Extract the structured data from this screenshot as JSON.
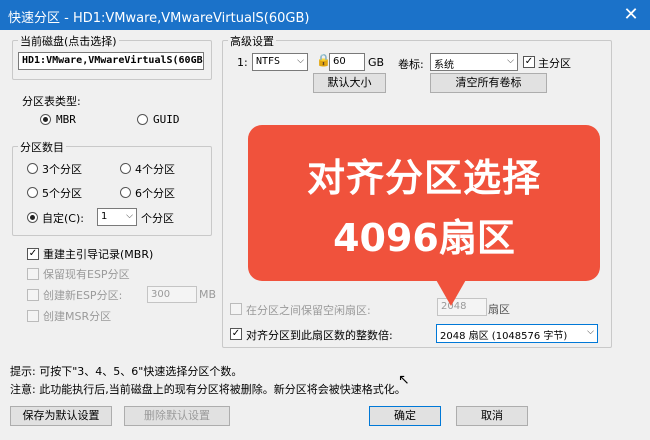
{
  "window": {
    "title": "快速分区 - HD1:VMware,VMwareVirtualS(60GB)"
  },
  "disk_panel": {
    "label": "当前磁盘(点击选择)",
    "value": "HD1:VMware,VMwareVirtualS(60GB)"
  },
  "partition_type": {
    "label": "分区表类型:",
    "options": [
      "MBR",
      "GUID"
    ],
    "selected": "MBR"
  },
  "partition_count": {
    "label": "分区数目",
    "options": [
      "3个分区",
      "4个分区",
      "5个分区",
      "6个分区"
    ],
    "custom_label": "自定(C):",
    "custom_value": "1",
    "custom_suffix": "个分区",
    "selected": "自定(C):"
  },
  "checkboxes": {
    "rebuild_mbr": "重建主引导记录(MBR)",
    "keep_esp": "保留现有ESP分区",
    "create_esp": "创建新ESP分区:",
    "esp_size": "300",
    "esp_unit": "MB",
    "create_msr": "创建MSR分区"
  },
  "advanced": {
    "label": "高级设置",
    "index": "1:",
    "fs": "NTFS",
    "size": "60",
    "size_unit": "GB",
    "volume_label_text": "卷标:",
    "volume_label": "系统",
    "primary_label": "主分区",
    "default_size_btn": "默认大小",
    "clear_labels_btn": "清空所有卷标",
    "keep_free_label": "在分区之间保留空闲扇区:",
    "keep_free_value": "2048",
    "keep_free_unit": "扇区",
    "align_label": "对齐分区到此扇区数的整数倍:",
    "align_value": "2048 扇区 (1048576 字节)"
  },
  "callout": {
    "line1": "对齐分区选择",
    "line2": "4096扇区"
  },
  "hints": {
    "tip": "提示: 可按下\"3、4、5、6\"快速选择分区个数。",
    "note": "注意: 此功能执行后,当前磁盘上的现有分区将被删除。新分区将会被快速格式化。"
  },
  "buttons": {
    "save_default": "保存为默认设置",
    "delete_default": "删除默认设置",
    "ok": "确定",
    "cancel": "取消"
  }
}
